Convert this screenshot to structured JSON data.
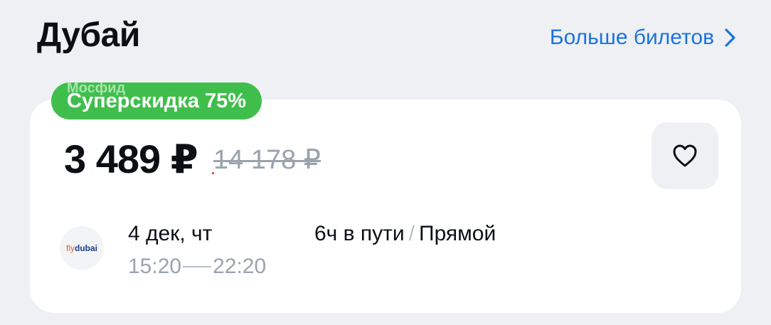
{
  "header": {
    "title": "Дубай",
    "more_link": "Больше билетов"
  },
  "offer": {
    "badge": "Суперскидка 75%",
    "watermark": "Мосфид",
    "price": "3 489 ₽",
    "old_price": "14 178 ₽"
  },
  "flight": {
    "airline_logo_prefix": "fly",
    "airline_logo_name": "dubai",
    "date": "4 дек, чт",
    "departure_time": "15:20",
    "arrival_time": "22:20",
    "duration": "6ч в пути",
    "separator": "/",
    "type": "Прямой"
  },
  "colors": {
    "accent": "#1a73e0",
    "badge": "#3fbe4c",
    "muted": "#9aa3ad",
    "background": "#eef0f3"
  },
  "icons": {
    "more": "chevron-right-icon",
    "favorite": "heart-outline-icon"
  }
}
